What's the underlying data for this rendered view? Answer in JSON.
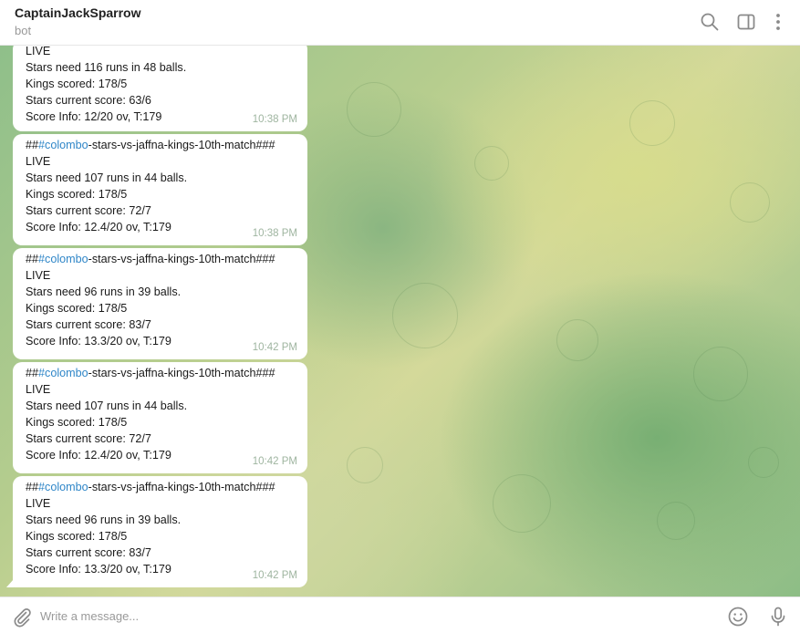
{
  "header": {
    "title": "CaptainJackSparrow",
    "subtitle": "bot"
  },
  "icons": {
    "search": "search-icon",
    "sidebar": "sidebar-toggle-icon",
    "more": "more-vertical-icon",
    "attach": "paperclip-icon",
    "emoji": "emoji-icon",
    "mic": "microphone-icon"
  },
  "colors": {
    "link": "#2f86c8",
    "bubble": "#ffffff",
    "time": "#9fb5a0"
  },
  "messages": [
    {
      "lines": [
        "LIVE",
        "Stars need 116 runs in 48 balls.",
        "Kings scored: 178/5",
        "Stars current score: 63/6",
        "Score Info: 12/20 ov, T:179"
      ],
      "time": "10:38 PM"
    },
    {
      "prefix": "##",
      "hashtag": "#colombo",
      "rest": "-stars-vs-jaffna-kings-10th-match###",
      "lines": [
        "LIVE",
        "Stars need 107 runs in 44 balls.",
        "Kings scored: 178/5",
        "Stars current score: 72/7",
        "Score Info: 12.4/20 ov, T:179"
      ],
      "time": "10:38 PM"
    },
    {
      "prefix": "##",
      "hashtag": "#colombo",
      "rest": "-stars-vs-jaffna-kings-10th-match###",
      "lines": [
        "LIVE",
        "Stars need 96 runs in 39 balls.",
        "Kings scored: 178/5",
        "Stars current score: 83/7",
        "Score Info: 13.3/20 ov, T:179"
      ],
      "time": "10:42 PM"
    },
    {
      "prefix": "##",
      "hashtag": "#colombo",
      "rest": "-stars-vs-jaffna-kings-10th-match###",
      "lines": [
        "LIVE",
        "Stars need 107 runs in 44 balls.",
        "Kings scored: 178/5",
        "Stars current score: 72/7",
        "Score Info: 12.4/20 ov, T:179"
      ],
      "time": "10:42 PM"
    },
    {
      "prefix": "##",
      "hashtag": "#colombo",
      "rest": "-stars-vs-jaffna-kings-10th-match###",
      "lines": [
        "LIVE",
        "Stars need 96 runs in 39 balls.",
        "Kings scored: 178/5",
        "Stars current score: 83/7",
        "Score Info: 13.3/20 ov, T:179"
      ],
      "time": "10:42 PM"
    }
  ],
  "composer": {
    "placeholder": "Write a message..."
  }
}
